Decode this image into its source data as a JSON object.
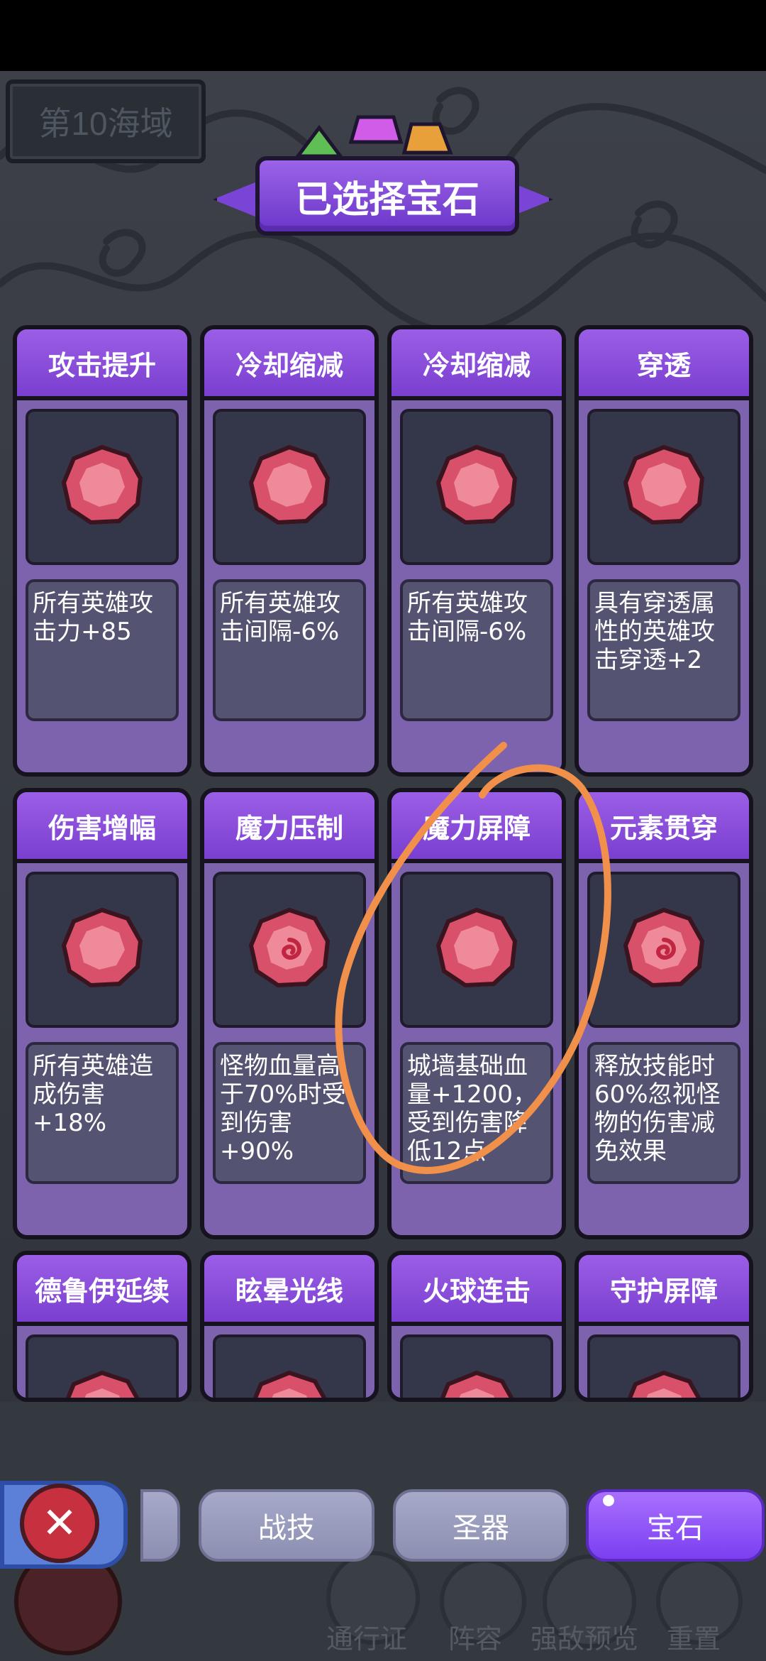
{
  "header": {
    "sea_region": "第10海域",
    "title": "已选择宝石"
  },
  "colors": {
    "accent": "#7b3fd0",
    "annotation": "#f0904a",
    "gem": "#d9506a"
  },
  "cards": [
    {
      "title": "攻击提升",
      "desc": "所有英雄攻击力+85",
      "icon": "gem-icon"
    },
    {
      "title": "冷却缩减",
      "desc": "所有英雄攻击间隔-6%",
      "icon": "gem-icon"
    },
    {
      "title": "冷却缩减",
      "desc": "所有英雄攻击间隔-6%",
      "icon": "gem-icon"
    },
    {
      "title": "穿透",
      "desc": "具有穿透属性的英雄攻击穿透+2",
      "icon": "gem-icon"
    },
    {
      "title": "伤害增幅",
      "desc": "所有英雄造成伤害+18%",
      "icon": "gem-icon"
    },
    {
      "title": "魔力压制",
      "desc": "怪物血量高于70%时受到伤害+90%",
      "icon": "swirl-gem-icon"
    },
    {
      "title": "魔力屏障",
      "desc": "城墙基础血量+1200，受到伤害降低12点",
      "icon": "gem-icon"
    },
    {
      "title": "元素贯穿",
      "desc": "释放技能时60%忽视怪物的伤害减免效果",
      "icon": "swirl-gem-icon"
    },
    {
      "title": "德鲁伊延续",
      "desc": "",
      "icon": "gem-icon"
    },
    {
      "title": "眩晕光线",
      "desc": "",
      "icon": "gem-icon"
    },
    {
      "title": "火球连击",
      "desc": "",
      "icon": "gem-icon"
    },
    {
      "title": "守护屏障",
      "desc": "",
      "icon": "gem-icon"
    }
  ],
  "tabs": {
    "skill": "战技",
    "relic": "圣器",
    "gem": "宝石"
  },
  "bottom_nav": {
    "pass": "通行证",
    "lineup": "阵容",
    "preview": "强敌预览",
    "reset": "重置"
  }
}
